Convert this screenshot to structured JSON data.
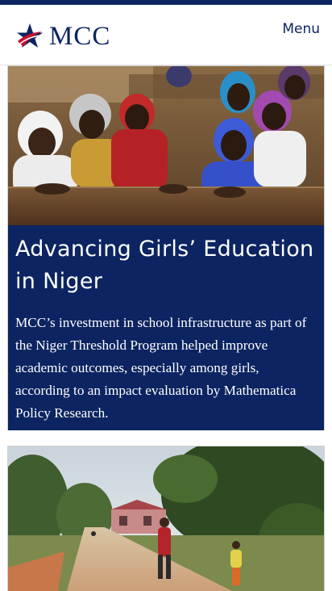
{
  "header": {
    "logo_text": "MCC",
    "logo_icon": "star-logo-icon",
    "menu_label": "Menu"
  },
  "stories": [
    {
      "image": "photo-schoolgirls-at-desks",
      "title": "Advancing Girls’ Education in Niger",
      "summary": "MCC’s investment in school infrastructure as part of the Niger Threshold Program helped improve academic outcomes, especially among girls, according to an impact evaluation by Mathematica Policy Research."
    },
    {
      "image": "photo-village-dirt-road"
    }
  ],
  "colors": {
    "brand_navy": "#0c2461",
    "brand_red": "#c8102e",
    "background": "#ffffff"
  }
}
